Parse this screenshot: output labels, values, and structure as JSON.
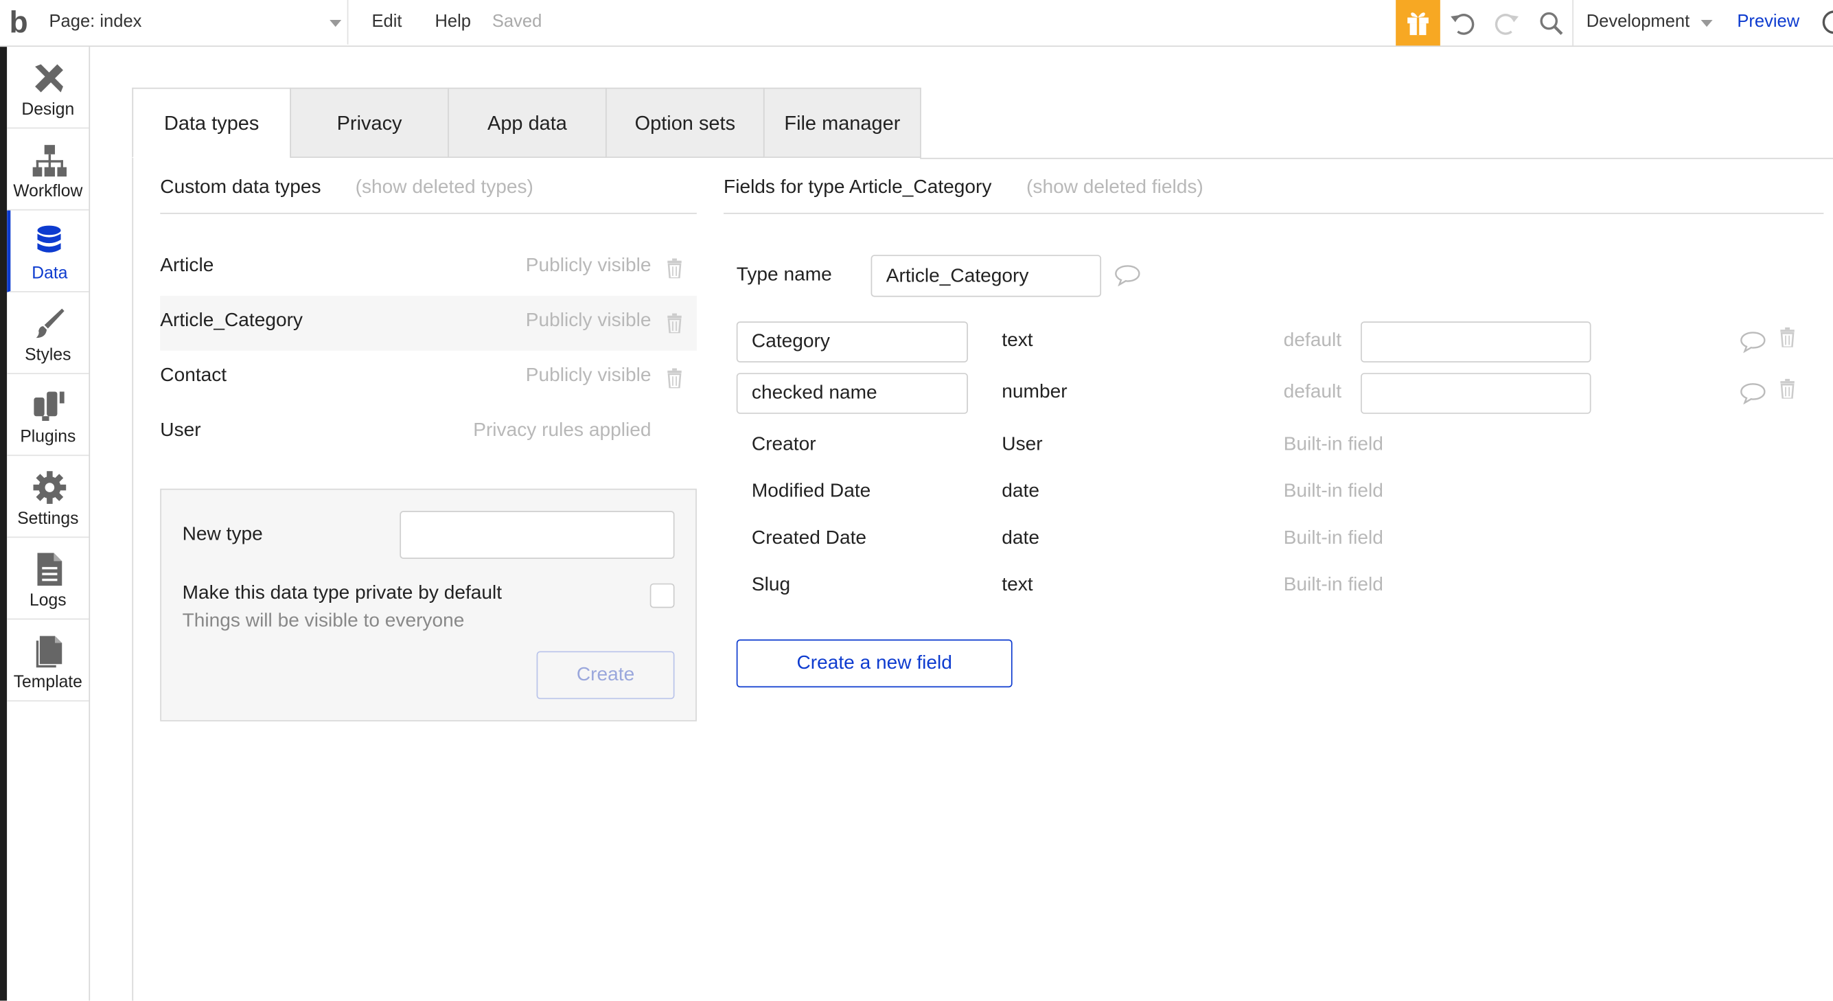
{
  "topbar": {
    "logo": "b",
    "page_selector": "Page: index",
    "menu_edit": "Edit",
    "menu_help": "Help",
    "save_status": "Saved",
    "environment": "Development",
    "preview": "Preview",
    "accent_color": "#f7a823"
  },
  "sidebar": {
    "items": [
      {
        "label": "Design",
        "icon": "design-icon"
      },
      {
        "label": "Workflow",
        "icon": "workflow-icon"
      },
      {
        "label": "Data",
        "icon": "database-icon",
        "active": true
      },
      {
        "label": "Styles",
        "icon": "brush-icon"
      },
      {
        "label": "Plugins",
        "icon": "plugin-icon"
      },
      {
        "label": "Settings",
        "icon": "gear-icon"
      },
      {
        "label": "Logs",
        "icon": "document-icon"
      },
      {
        "label": "Template",
        "icon": "copy-icon"
      }
    ],
    "active_color": "#0d3bcf"
  },
  "tabs": [
    "Data types",
    "Privacy",
    "App data",
    "Option sets",
    "File manager"
  ],
  "types_panel": {
    "heading": "Custom data types",
    "show_deleted": "(show deleted types)",
    "types": [
      {
        "name": "Article",
        "visibility": "Publicly visible"
      },
      {
        "name": "Article_Category",
        "visibility": "Publicly visible"
      },
      {
        "name": "Contact",
        "visibility": "Publicly visible"
      },
      {
        "name": "User",
        "visibility": "Privacy rules applied"
      }
    ],
    "new_type_label": "New type",
    "new_type_value": "",
    "private_label": "Make this data type private by default",
    "private_hint": "Things will be visible to everyone",
    "create_button": "Create"
  },
  "fields_panel": {
    "heading": "Fields for type Article_Category",
    "show_deleted": "(show deleted fields)",
    "type_name_label": "Type name",
    "type_name_value": "Article_Category",
    "editable_fields": [
      {
        "name": "Category",
        "type": "text",
        "default_label": "default",
        "default_value": ""
      },
      {
        "name": "checked name",
        "type": "number",
        "default_label": "default",
        "default_value": ""
      }
    ],
    "builtin_fields": [
      {
        "name": "Creator",
        "type": "User",
        "note": "Built-in field"
      },
      {
        "name": "Modified Date",
        "type": "date",
        "note": "Built-in field"
      },
      {
        "name": "Created Date",
        "type": "date",
        "note": "Built-in field"
      },
      {
        "name": "Slug",
        "type": "text",
        "note": "Built-in field"
      }
    ],
    "create_field_button": "Create a new field",
    "button_color": "#0d3bcf"
  }
}
